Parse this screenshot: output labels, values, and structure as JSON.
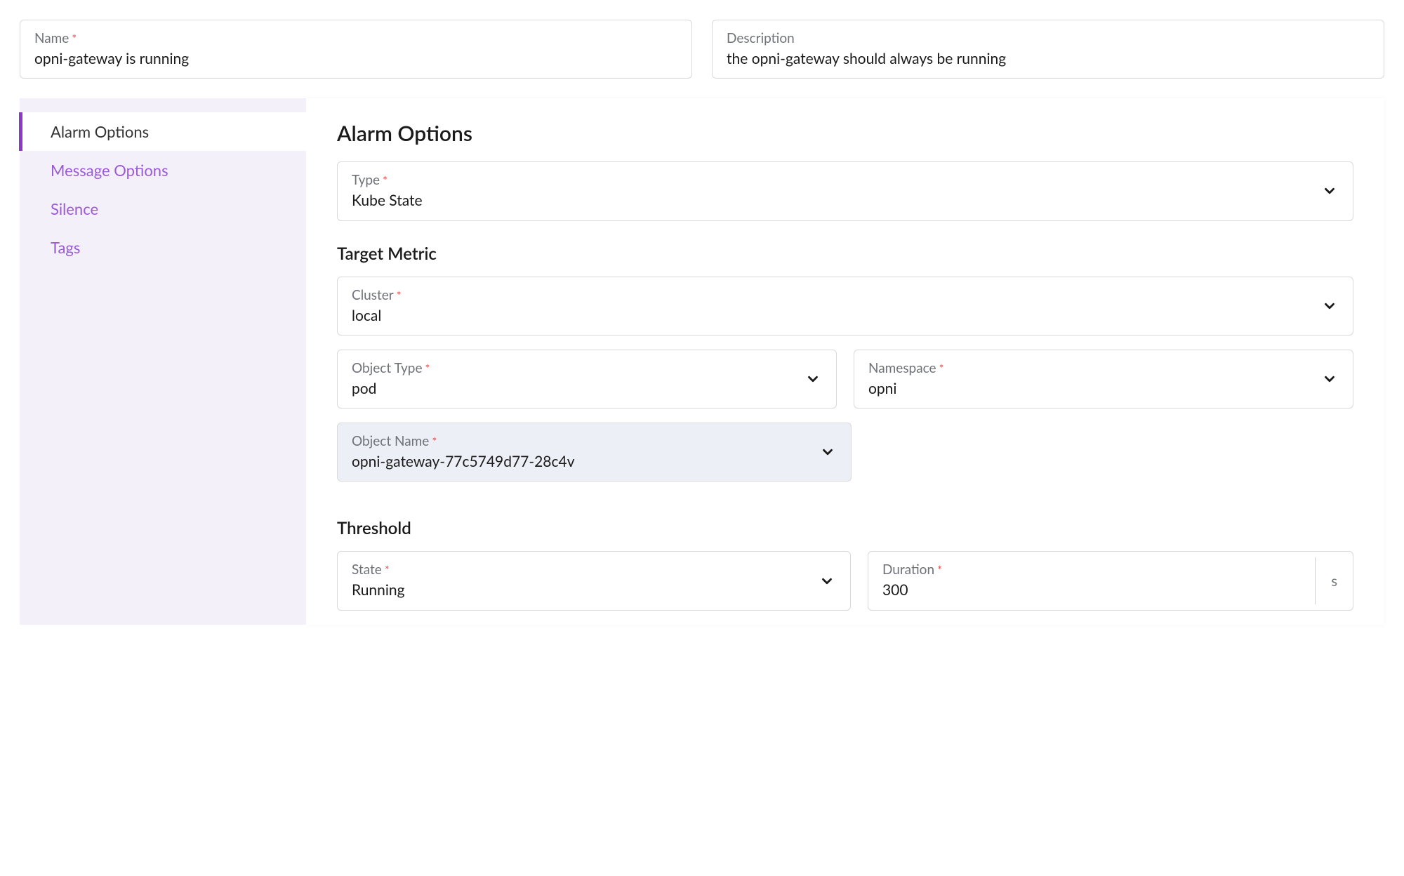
{
  "header": {
    "name_label": "Name",
    "name_value": "opni-gateway is running",
    "description_label": "Description",
    "description_value": "the opni-gateway should always be running"
  },
  "sidebar": {
    "items": [
      {
        "label": "Alarm Options",
        "active": true
      },
      {
        "label": "Message Options",
        "active": false
      },
      {
        "label": "Silence",
        "active": false
      },
      {
        "label": "Tags",
        "active": false
      }
    ]
  },
  "main": {
    "title": "Alarm Options",
    "type_label": "Type",
    "type_value": "Kube State",
    "target_metric_title": "Target Metric",
    "cluster_label": "Cluster",
    "cluster_value": "local",
    "object_type_label": "Object Type",
    "object_type_value": "pod",
    "namespace_label": "Namespace",
    "namespace_value": "opni",
    "object_name_label": "Object Name",
    "object_name_value": "opni-gateway-77c5749d77-28c4v",
    "threshold_title": "Threshold",
    "state_label": "State",
    "state_value": "Running",
    "duration_label": "Duration",
    "duration_value": "300",
    "duration_unit": "s"
  }
}
